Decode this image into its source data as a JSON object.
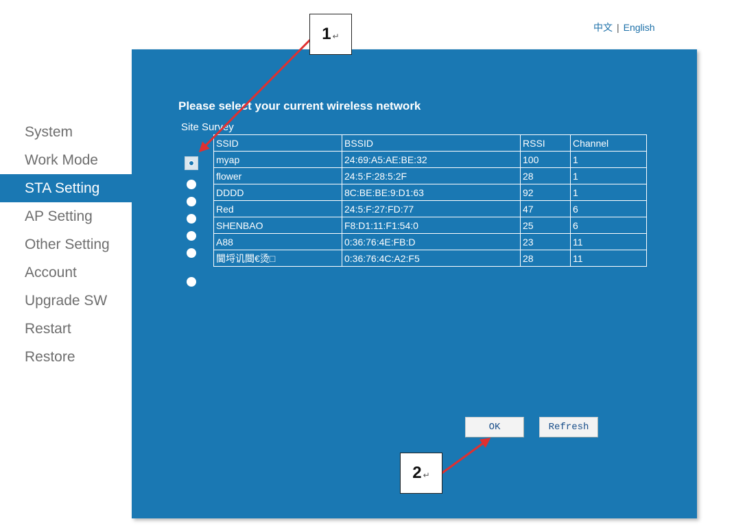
{
  "language": {
    "chinese": "中文",
    "separator": "|",
    "english": "English"
  },
  "sidebar": {
    "items": [
      {
        "label": "System",
        "active": false
      },
      {
        "label": "Work Mode",
        "active": false
      },
      {
        "label": "STA Setting",
        "active": true
      },
      {
        "label": "AP Setting",
        "active": false
      },
      {
        "label": "Other Setting",
        "active": false
      },
      {
        "label": "Account",
        "active": false
      },
      {
        "label": "Upgrade SW",
        "active": false
      },
      {
        "label": "Restart",
        "active": false
      },
      {
        "label": "Restore",
        "active": false
      }
    ]
  },
  "main": {
    "heading": "Please select your current wireless network",
    "subheading": "Site Survey",
    "columns": [
      "SSID",
      "BSSID",
      "RSSI",
      "Channel"
    ],
    "rows": [
      {
        "ssid": "myap",
        "bssid": "24:69:A5:AE:BE:32",
        "rssi": "100",
        "channel": "1",
        "selected": true
      },
      {
        "ssid": "flower",
        "bssid": "24:5:F:28:5:2F",
        "rssi": "28",
        "channel": "1",
        "selected": false
      },
      {
        "ssid": "DDDD",
        "bssid": "8C:BE:BE:9:D1:63",
        "rssi": "92",
        "channel": "1",
        "selected": false
      },
      {
        "ssid": "Red",
        "bssid": "24:5:F:27:FD:77",
        "rssi": "47",
        "channel": "6",
        "selected": false
      },
      {
        "ssid": "SHENBAO",
        "bssid": "F8:D1:11:F1:54:0",
        "rssi": "25",
        "channel": "6",
        "selected": false
      },
      {
        "ssid": "A88",
        "bssid": "0:36:76:4E:FB:D",
        "rssi": "23",
        "channel": "11",
        "selected": false
      },
      {
        "ssid": "閫埒讥閸€烫□",
        "bssid": "0:36:76:4C:A2:F5",
        "rssi": "28",
        "channel": "11",
        "selected": false
      }
    ],
    "ok_label": "OK",
    "refresh_label": "Refresh"
  },
  "callouts": {
    "one": "1",
    "two": "2",
    "return_mark": "↵"
  },
  "colors": {
    "panel": "#1a78b3",
    "arrow": "#e03030",
    "nav_active": "#1a78b3"
  }
}
